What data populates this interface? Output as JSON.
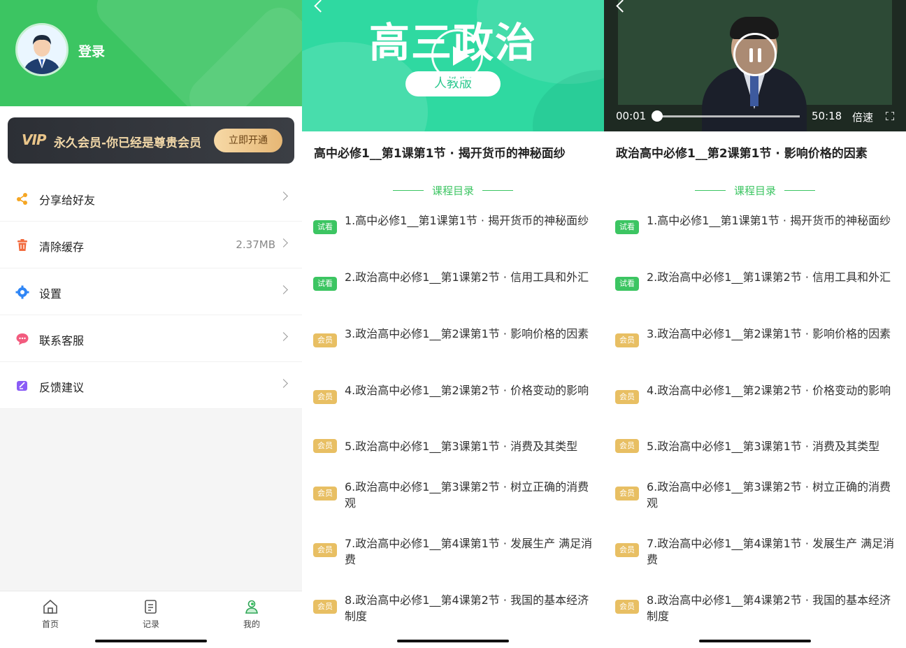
{
  "profile": {
    "login_label": "登录",
    "vip_logo": "VIP",
    "vip_text": "永久会员-你已经是尊贵会员",
    "vip_button": "立即开通",
    "menu": [
      {
        "label": "分享给好友",
        "value": "",
        "icon": "share-icon"
      },
      {
        "label": "清除缓存",
        "value": "2.37MB",
        "icon": "trash-icon"
      },
      {
        "label": "设置",
        "value": "",
        "icon": "gear-icon"
      },
      {
        "label": "联系客服",
        "value": "",
        "icon": "chat-bubble-icon"
      },
      {
        "label": "反馈建议",
        "value": "",
        "icon": "feedback-icon"
      }
    ],
    "tabs": [
      {
        "label": "首页",
        "icon": "home-icon"
      },
      {
        "label": "记录",
        "icon": "record-icon"
      },
      {
        "label": "我的",
        "icon": "user-icon",
        "active": true
      }
    ],
    "colors": {
      "brand": "#3cc562",
      "vip_gold": "#e8bf63"
    }
  },
  "course_page": {
    "banner_title": "高三政治",
    "banner_pill": "人教版",
    "title": "高中必修1__第1课第1节 · 揭开货币的神秘面纱"
  },
  "player_page": {
    "current_time": "00:01",
    "total_time": "50:18",
    "speed_label": "倍速",
    "progress": 0.0,
    "title": "政治高中必修1__第2课第1节 · 影响价格的因素"
  },
  "toc": {
    "heading": "课程目录",
    "lessons": [
      {
        "badge": "试看",
        "type": "trial",
        "text": "1.高中必修1__第1课第1节 · 揭开货币的神秘面纱"
      },
      {
        "badge": "试看",
        "type": "trial",
        "text": "2.政治高中必修1__第1课第2节 · 信用工具和外汇"
      },
      {
        "badge": "会员",
        "type": "member",
        "text": "3.政治高中必修1__第2课第1节 · 影响价格的因素"
      },
      {
        "badge": "会员",
        "type": "member",
        "text": "4.政治高中必修1__第2课第2节 · 价格变动的影响"
      },
      {
        "badge": "会员",
        "type": "member",
        "text": "5.政治高中必修1__第3课第1节 · 消费及其类型"
      },
      {
        "badge": "会员",
        "type": "member",
        "text": "6.政治高中必修1__第3课第2节 · 树立正确的消费观"
      },
      {
        "badge": "会员",
        "type": "member",
        "text": "7.政治高中必修1__第4课第1节 · 发展生产 满足消费"
      },
      {
        "badge": "会员",
        "type": "member",
        "text": "8.政治高中必修1__第4课第2节 · 我国的基本经济制度"
      }
    ]
  }
}
